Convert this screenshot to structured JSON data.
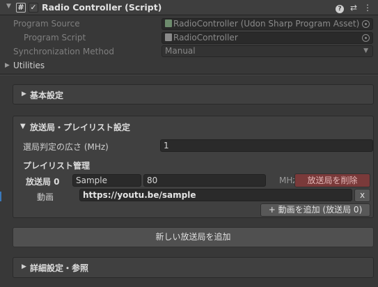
{
  "header": {
    "hash_glyph": "#",
    "check_glyph": "✓",
    "title": "Radio Controller (Script)",
    "help_glyph": "?",
    "settings_glyph": "⇄",
    "menu_glyph": "⋮"
  },
  "properties": {
    "program_source_label": "Program Source",
    "program_source_value": "RadioController (Udon Sharp Program Asset)",
    "program_script_label": "Program Script",
    "program_script_value": "RadioController",
    "sync_label": "Synchronization Method",
    "sync_value": "Manual",
    "utilities_label": "Utilities"
  },
  "sections": {
    "basic_label": "基本設定",
    "broadcast_label": "放送局・プレイリスト設定",
    "range_label": "選局判定の広さ (MHz)",
    "range_value": "1",
    "playlist_header": "プレイリスト管理",
    "station_label": "放送局 0",
    "station_name_value": "Sample",
    "station_freq_value": "80",
    "freq_unit": "MHz",
    "delete_station_button": "放送局を削除",
    "video_label": "動画",
    "video_url_value": "https://youtu.be/sample",
    "remove_video_button": "x",
    "add_video_button": "+ 動画を追加 (放送局 0)",
    "add_station_button": "新しい放送局を追加",
    "advanced_label": "詳細設定・参照"
  },
  "glyphs": {
    "collapsed": "▶",
    "expanded": "▼",
    "dropdown_caret": "▼"
  }
}
